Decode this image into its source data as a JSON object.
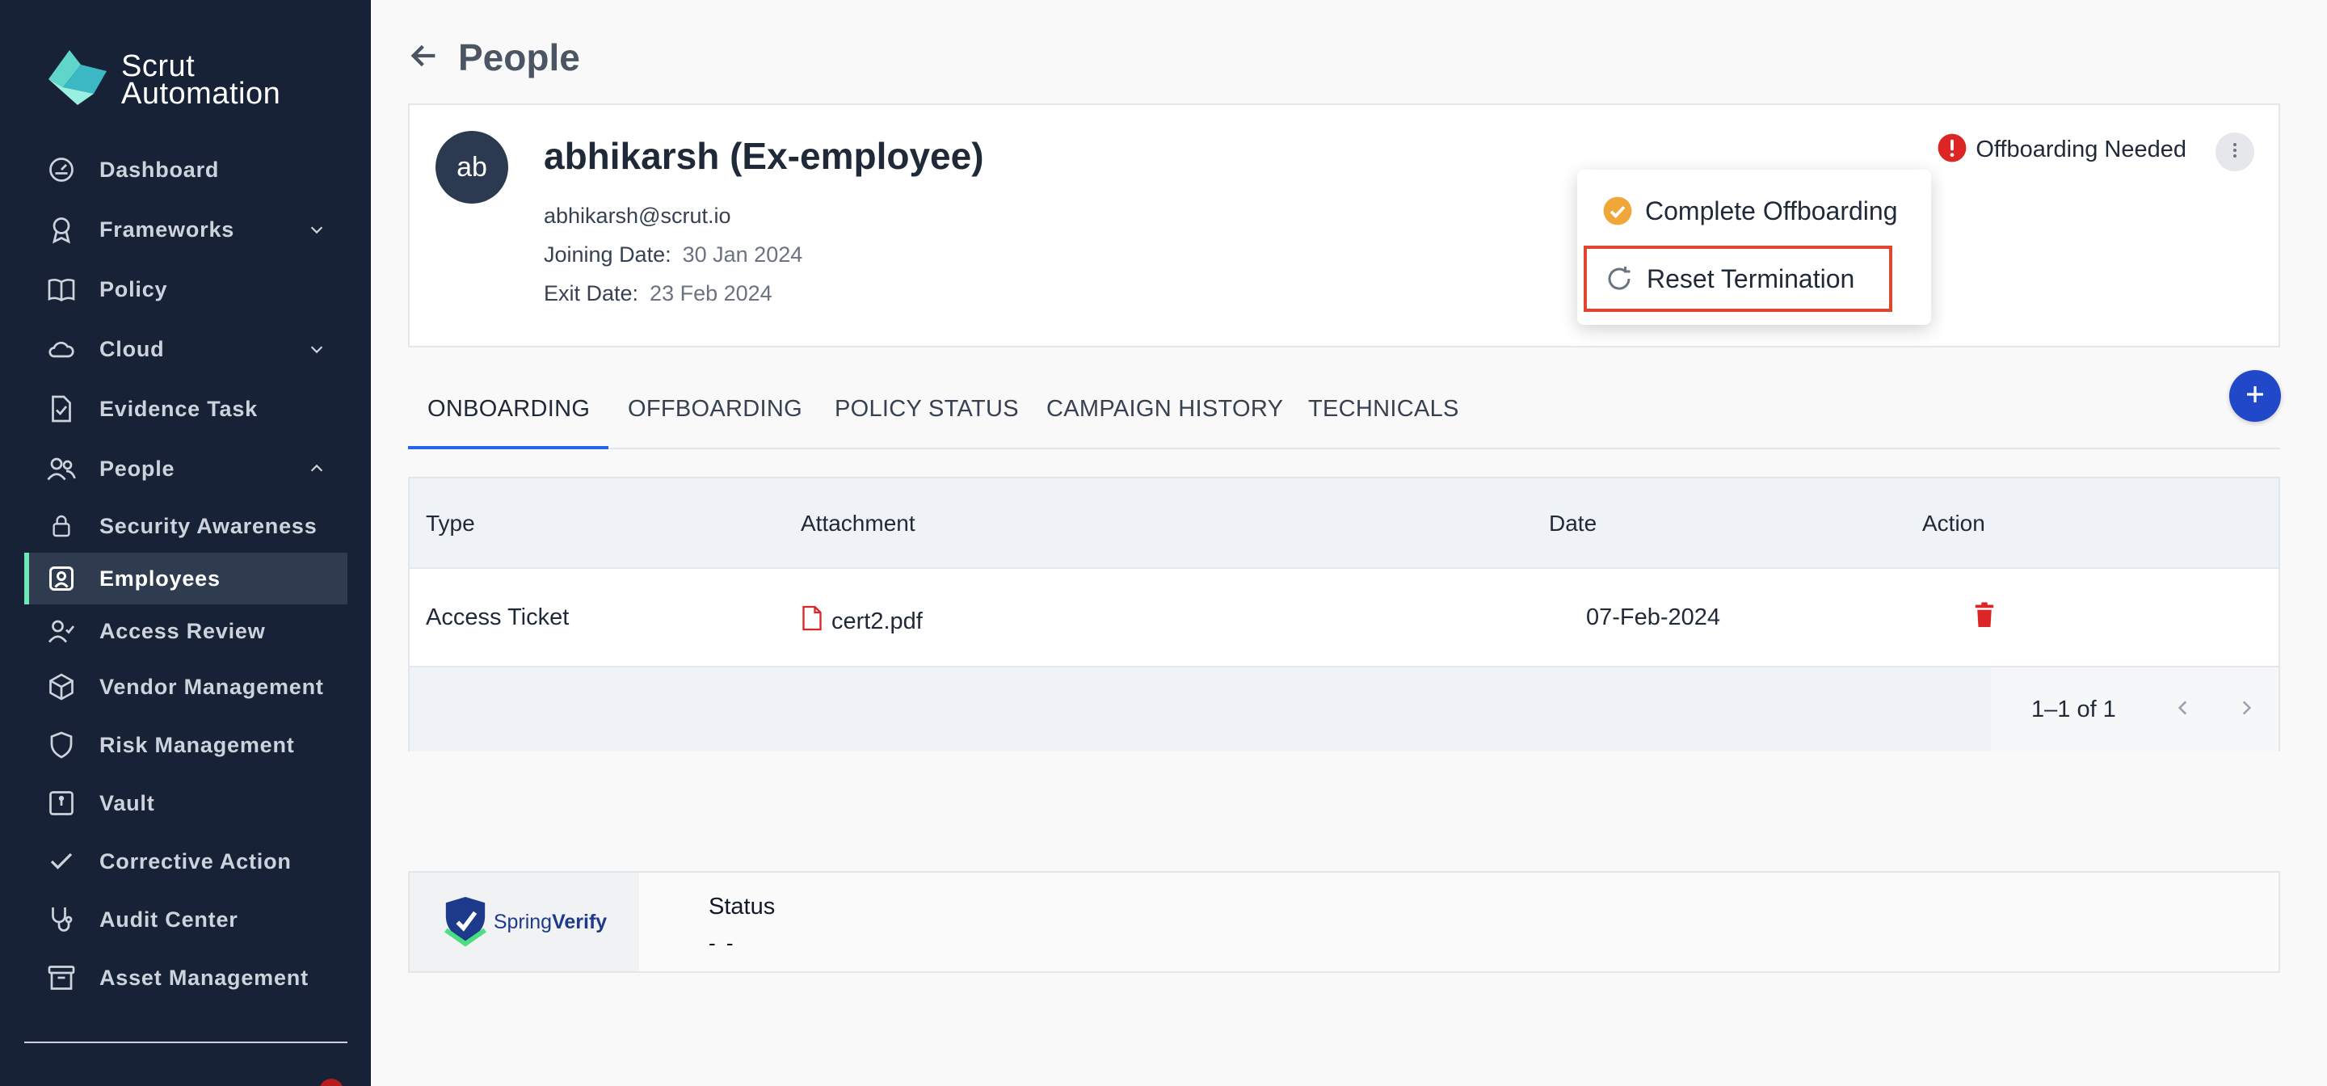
{
  "brand": {
    "line1": "Scrut",
    "line2": "Automation"
  },
  "sidebar": {
    "items": [
      {
        "label": "Dashboard",
        "icon": "dashboard-icon"
      },
      {
        "label": "Frameworks",
        "icon": "award-icon",
        "chevron": "down"
      },
      {
        "label": "Policy",
        "icon": "book-icon"
      },
      {
        "label": "Cloud",
        "icon": "cloud-icon",
        "chevron": "down"
      },
      {
        "label": "Evidence Task",
        "icon": "document-check-icon"
      },
      {
        "label": "People",
        "icon": "users-icon",
        "chevron": "up"
      },
      {
        "label": "Security Awareness",
        "icon": "lock-icon"
      },
      {
        "label": "Employees",
        "icon": "id-card-icon",
        "active": true
      },
      {
        "label": "Access Review",
        "icon": "user-check-icon"
      },
      {
        "label": "Vendor Management",
        "icon": "box-icon"
      },
      {
        "label": "Risk Management",
        "icon": "shield-icon"
      },
      {
        "label": "Vault",
        "icon": "vault-icon"
      },
      {
        "label": "Corrective Action",
        "icon": "check-icon"
      },
      {
        "label": "Audit Center",
        "icon": "stethoscope-icon"
      },
      {
        "label": "Asset Management",
        "icon": "archive-icon"
      }
    ]
  },
  "header": {
    "title": "People"
  },
  "employee": {
    "initials": "ab",
    "name": "abhikarsh (Ex-employee)",
    "email": "abhikarsh@scrut.io",
    "joining_label": "Joining Date:",
    "joining_value": "30 Jan 2024",
    "exit_label": "Exit Date:",
    "exit_value": "23 Feb 2024",
    "status": "Offboarding Needed"
  },
  "menu": {
    "complete": "Complete Offboarding",
    "reset": "Reset Termination"
  },
  "tabs": [
    "ONBOARDING",
    "OFFBOARDING",
    "POLICY STATUS",
    "CAMPAIGN HISTORY",
    "TECHNICALS"
  ],
  "table": {
    "headers": [
      "Type",
      "Attachment",
      "Date",
      "Action"
    ],
    "rows": [
      {
        "type": "Access Ticket",
        "attachment": "cert2.pdf",
        "date": "07-Feb-2024"
      }
    ],
    "pagination": "1–1 of 1"
  },
  "verify": {
    "logo_a": "Spring",
    "logo_b": "Verify",
    "status_label": "Status",
    "status_value": "- -"
  },
  "colors": {
    "sidebar_bg": "#172236",
    "accent_green": "#6ee7b7",
    "primary_blue": "#2148c9",
    "alert_red": "#dc2626",
    "success_orange": "#f0a73a"
  }
}
